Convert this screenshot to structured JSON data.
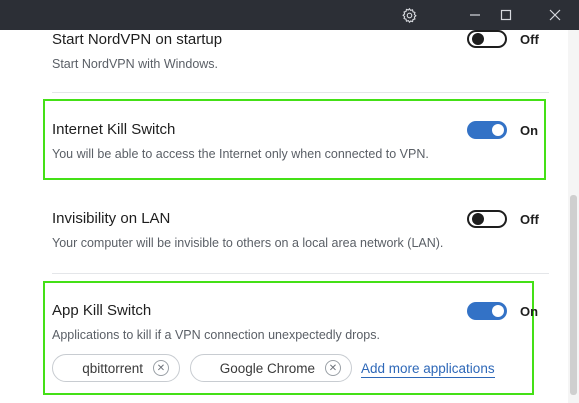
{
  "window": {
    "icons": {
      "settings": "gear-icon",
      "minimize": "minimize-icon",
      "maximize": "maximize-icon",
      "close": "close-icon"
    }
  },
  "settings": [
    {
      "id": "startup",
      "title": "Start NordVPN on startup",
      "description": "Start NordVPN with Windows.",
      "state": "Off",
      "enabled": false
    },
    {
      "id": "internet-kill-switch",
      "title": "Internet Kill Switch",
      "description": "You will be able to access the Internet only when connected to VPN.",
      "state": "On",
      "enabled": true
    },
    {
      "id": "invisibility-lan",
      "title": "Invisibility on LAN",
      "description": "Your computer will be invisible to others on a local area network (LAN).",
      "state": "Off",
      "enabled": false
    },
    {
      "id": "app-kill-switch",
      "title": "App Kill Switch",
      "description": "Applications to kill if a VPN connection unexpectedly drops.",
      "state": "On",
      "enabled": true
    }
  ],
  "app_kill_switch": {
    "apps": [
      "qbittorrent",
      "Google Chrome"
    ],
    "add_link": "Add more applications"
  },
  "colors": {
    "highlight": "#44e016",
    "toggle_on": "#3372c6",
    "link": "#2e68b8",
    "titlebar": "#2c2f36"
  }
}
